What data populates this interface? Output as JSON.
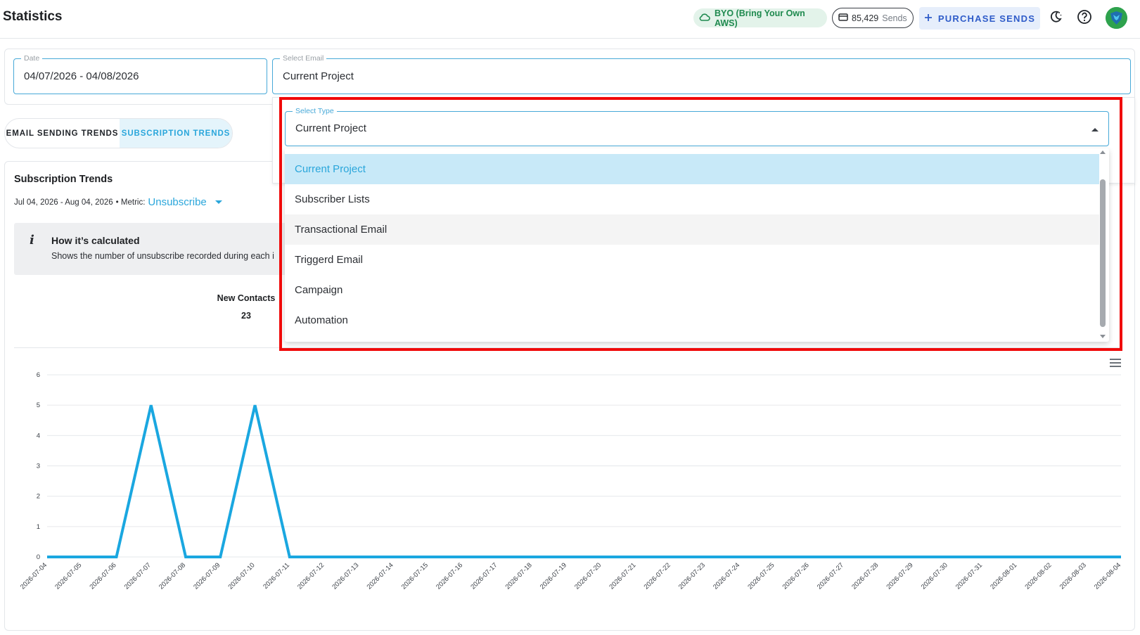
{
  "header": {
    "title": "Statistics",
    "byo_label": "BYO (Bring Your Own AWS)",
    "sends_count": "85,429",
    "sends_label": "Sends",
    "purchase_label": "PURCHASE SENDS",
    "icons": [
      "cloud-icon",
      "card-icon",
      "plus-icon",
      "moon-icon",
      "help-icon"
    ]
  },
  "filters": {
    "date_label": "Date",
    "date_value": "04/07/2026 - 04/08/2026",
    "email_label": "Select Email",
    "email_value": "Current Project"
  },
  "tabs": [
    {
      "label": "EMAIL SENDING TRENDS",
      "active": false
    },
    {
      "label": "SUBSCRIPTION TRENDS",
      "active": true
    }
  ],
  "trends": {
    "title": "Subscription Trends",
    "range": "Jul 04, 2026 - Aug 04, 2026",
    "metric_prefix": "• Metric:",
    "metric_value": "Unsubscribe",
    "info_heading": "How it’s calculated",
    "info_text": "Shows the number of unsubscribe recorded during each i",
    "stat_label": "New Contacts",
    "stat_value": "23"
  },
  "type_select": {
    "label": "Select Type",
    "value": "Current Project",
    "options": [
      {
        "label": "Current Project",
        "state": "selected"
      },
      {
        "label": "Subscriber Lists",
        "state": "normal"
      },
      {
        "label": "Transactional Email",
        "state": "hovered"
      },
      {
        "label": "Triggerd Email",
        "state": "normal"
      },
      {
        "label": "Campaign",
        "state": "normal"
      },
      {
        "label": "Automation",
        "state": "normal"
      }
    ]
  },
  "colors": {
    "accent": "#2aa6db",
    "line": "#1aa7e0",
    "highlight": "#f00a0a",
    "byo_green": "#1f8a4f",
    "purchase_blue": "#2f5cc9"
  },
  "chart_data": {
    "type": "line",
    "x": [
      "2026-07-04",
      "2026-07-05",
      "2026-07-06",
      "2026-07-07",
      "2026-07-08",
      "2026-07-09",
      "2026-07-10",
      "2026-07-11",
      "2026-07-12",
      "2026-07-13",
      "2026-07-14",
      "2026-07-15",
      "2026-07-16",
      "2026-07-17",
      "2026-07-18",
      "2026-07-19",
      "2026-07-20",
      "2026-07-21",
      "2026-07-22",
      "2026-07-23",
      "2026-07-24",
      "2026-07-25",
      "2026-07-26",
      "2026-07-27",
      "2026-07-28",
      "2026-07-29",
      "2026-07-30",
      "2026-07-31",
      "2026-08-01",
      "2026-08-02",
      "2026-08-03",
      "2026-08-04"
    ],
    "series": [
      {
        "values": [
          0,
          0,
          0,
          5,
          0,
          0,
          5,
          0,
          0,
          0,
          0,
          0,
          0,
          0,
          0,
          0,
          0,
          0,
          0,
          0,
          0,
          0,
          0,
          0,
          0,
          0,
          0,
          0,
          0,
          0,
          0,
          0
        ]
      }
    ],
    "yticks": [
      0,
      1,
      2,
      3,
      4,
      5,
      6
    ],
    "ylim": [
      0,
      6
    ],
    "grid": true
  }
}
